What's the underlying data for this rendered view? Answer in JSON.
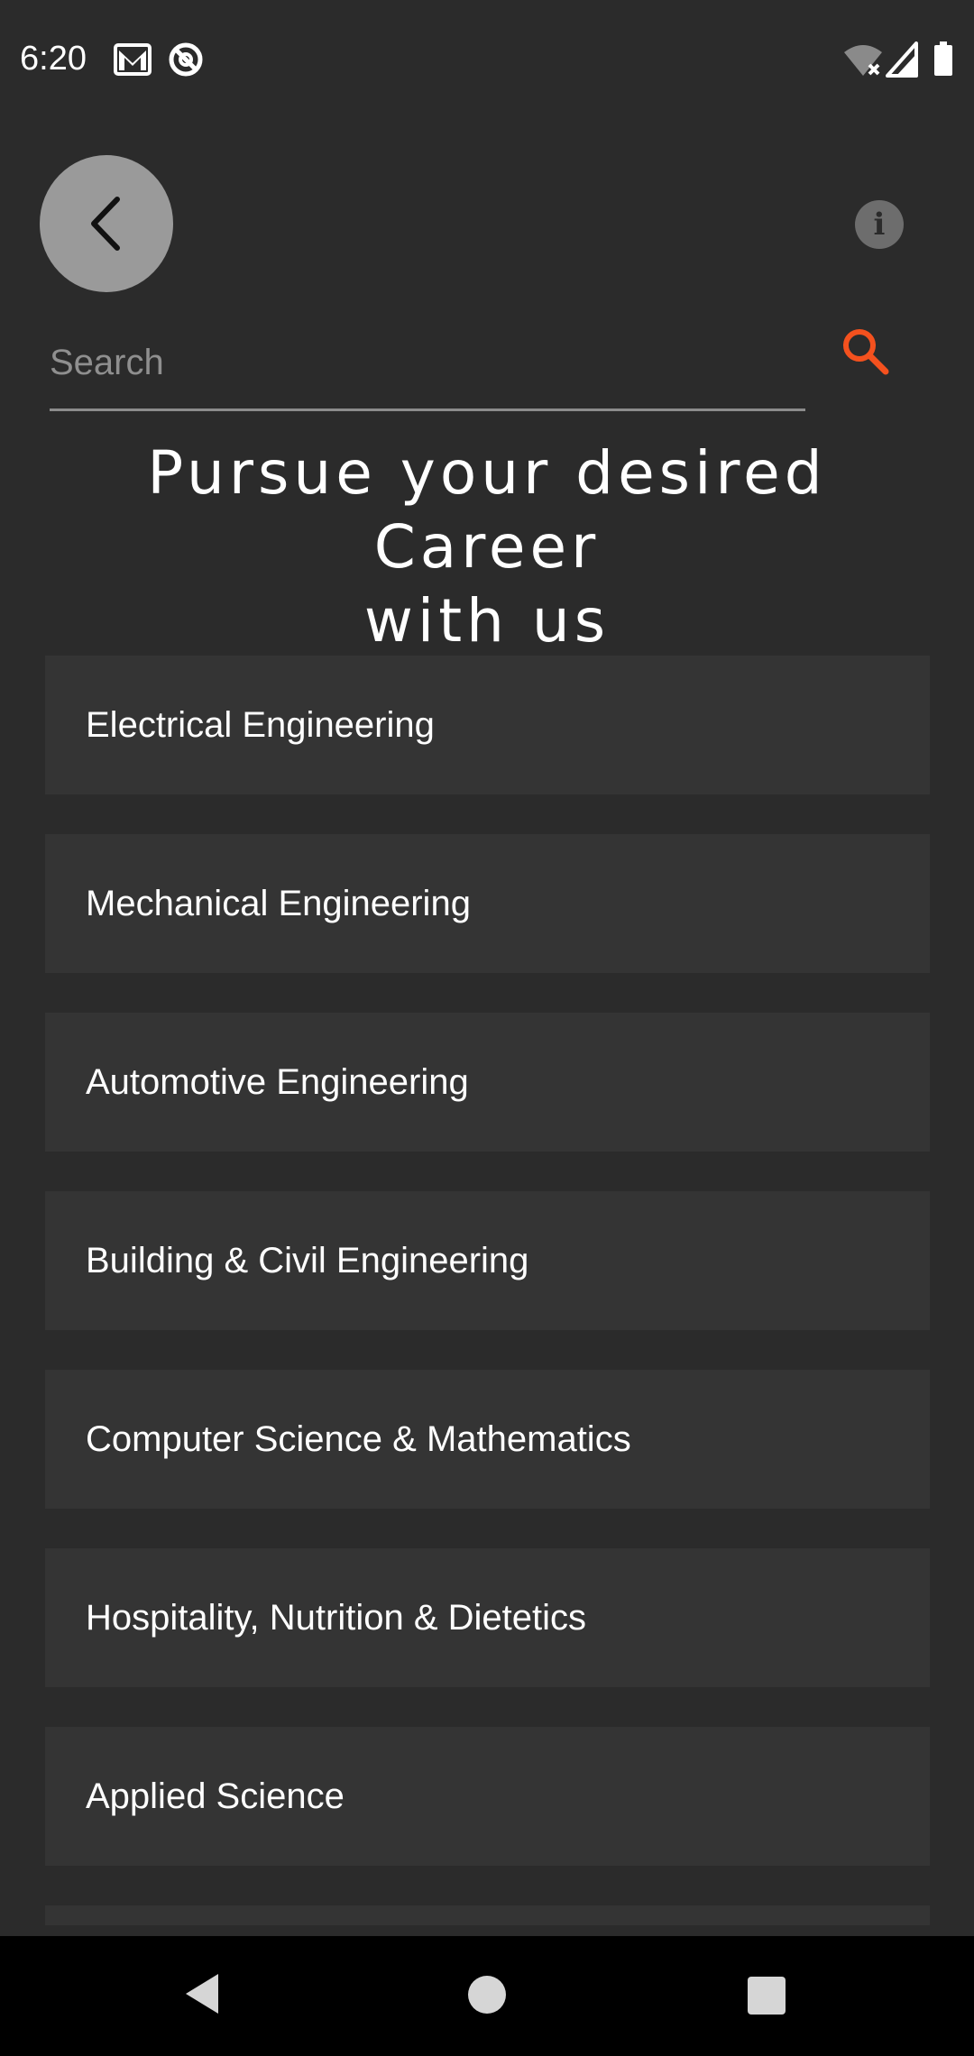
{
  "status_bar": {
    "time": "6:20",
    "icons": [
      "gmail-icon",
      "no-disturb-icon",
      "wifi-off-icon",
      "signal-icon",
      "battery-icon"
    ]
  },
  "header": {
    "back_icon": "chevron-left-icon",
    "info_icon": "info-icon",
    "info_glyph": "i"
  },
  "search": {
    "placeholder": "Search",
    "value": "",
    "icon": "search-icon",
    "accent_color": "#f4511e"
  },
  "title": {
    "line1": "Pursue your desired Career",
    "line2": "with us"
  },
  "careers": [
    {
      "label": "Electrical Engineering"
    },
    {
      "label": "Mechanical Engineering"
    },
    {
      "label": "Automotive Engineering"
    },
    {
      "label": "Building & Civil Engineering"
    },
    {
      "label": "Computer Science & Mathematics"
    },
    {
      "label": "Hospitality, Nutrition & Dietetics"
    },
    {
      "label": "Applied Science"
    },
    {
      "label": ""
    }
  ],
  "nav_bar": {
    "buttons": [
      "back-icon",
      "home-icon",
      "recents-icon"
    ]
  },
  "colors": {
    "background": "#2b2b2b",
    "card": "#343434",
    "back_button": "#9a9a9a",
    "accent": "#f4511e"
  }
}
